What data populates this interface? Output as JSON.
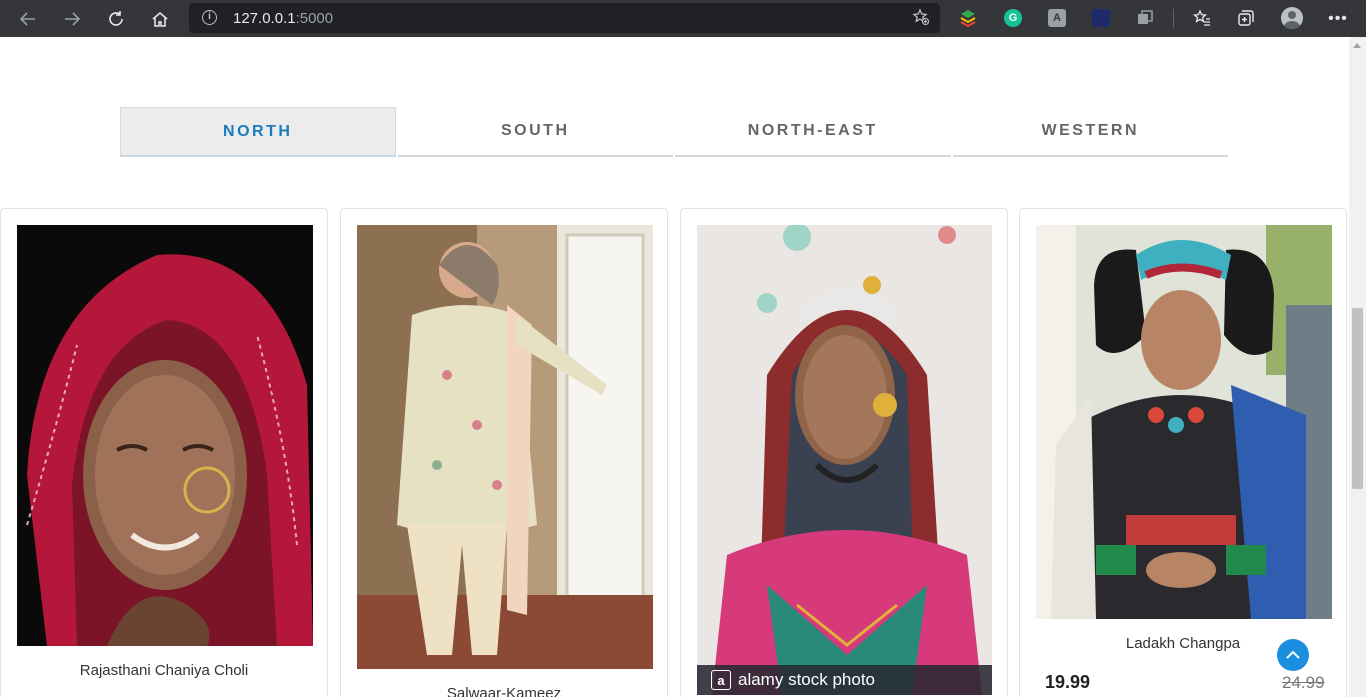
{
  "browser": {
    "url_host": "127.0.0.1",
    "url_port": ":5000",
    "icons": [
      "back-icon",
      "forward-icon",
      "reload-icon",
      "home-icon",
      "site-info-icon",
      "add-favorite-icon",
      "favorites-icon",
      "collections-icon",
      "profile-icon",
      "more-icon"
    ]
  },
  "tabs": [
    {
      "label": "NORTH",
      "active": true
    },
    {
      "label": "SOUTH",
      "active": false
    },
    {
      "label": "NORTH-EAST",
      "active": false
    },
    {
      "label": "WESTERN",
      "active": false
    }
  ],
  "products": [
    {
      "name": "Rajasthani Chaniya Choli"
    },
    {
      "name": "Salwaar-Kameez"
    },
    {
      "name": "",
      "watermark": "alamy stock photo"
    },
    {
      "name": "Ladakh Changpa",
      "price": "19.99",
      "old_price": "24.99"
    }
  ],
  "colors": {
    "accent": "#1a7bb9",
    "scroll_top_button": "#1a8fe0"
  }
}
